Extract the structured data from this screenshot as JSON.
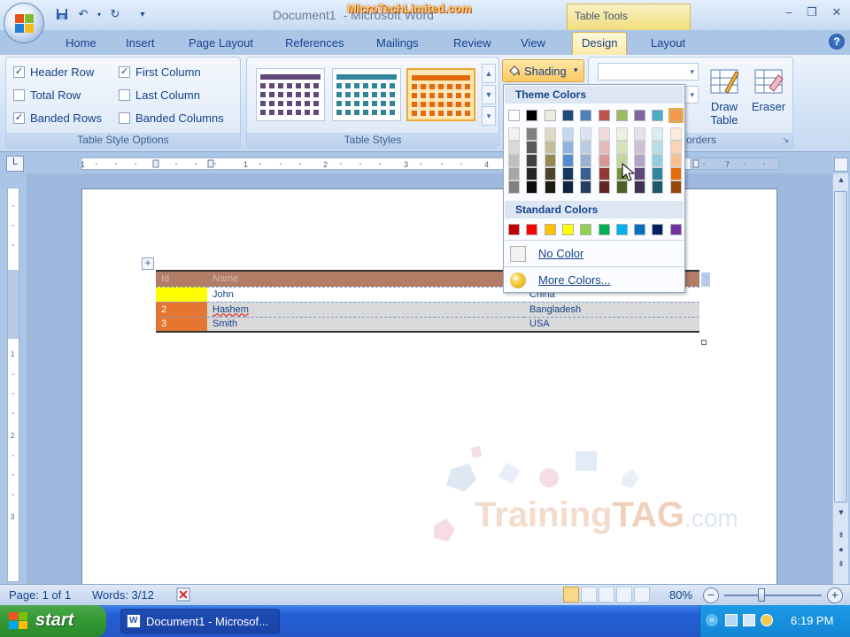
{
  "window": {
    "title": "Document1",
    "title_suffix": "- Microsoft Word",
    "overlay_text": "MicroTechLimited.com",
    "context_tab": "Table Tools",
    "controls": [
      "–",
      "❐",
      "✕"
    ]
  },
  "ribbon_tabs": [
    "Home",
    "Insert",
    "Page Layout",
    "References",
    "Mailings",
    "Review",
    "View",
    "Design",
    "Layout"
  ],
  "active_tab": "Design",
  "table_style_options": {
    "label": "Table Style Options",
    "items": [
      {
        "label": "Header Row",
        "checked": true,
        "mark": "✓"
      },
      {
        "label": "First Column",
        "checked": true,
        "mark": "✓"
      },
      {
        "label": "Total Row",
        "checked": false,
        "mark": ""
      },
      {
        "label": "Last Column",
        "checked": false,
        "mark": ""
      },
      {
        "label": "Banded Rows",
        "checked": true,
        "mark": "✓"
      },
      {
        "label": "Banded Columns",
        "checked": false,
        "mark": ""
      }
    ]
  },
  "table_styles": {
    "label": "Table Styles",
    "thumb_colors": [
      "#5f497a",
      "#31859b",
      "#e36c09"
    ]
  },
  "shading": {
    "label": "Shading"
  },
  "draw_borders": {
    "label": "Draw Borders",
    "visible_label": "orders",
    "draw_table": "Draw\nTable",
    "eraser": "Eraser"
  },
  "shading_menu": {
    "theme_header": "Theme Colors",
    "standard_header": "Standard Colors",
    "no_color": "No Color",
    "more_colors": "More Colors...",
    "theme_top_row": [
      "#ffffff",
      "#000000",
      "#eeece1",
      "#1f497d",
      "#4f81bd",
      "#c0504d",
      "#9bbb59",
      "#8064a2",
      "#4bacc6",
      "#f79646"
    ],
    "theme_columns": [
      [
        "#f2f2f2",
        "#d9d9d9",
        "#bfbfbf",
        "#a6a6a6",
        "#808080"
      ],
      [
        "#7f7f7f",
        "#595959",
        "#404040",
        "#262626",
        "#0d0d0d"
      ],
      [
        "#ddd9c3",
        "#c4bd97",
        "#938953",
        "#4a452a",
        "#1e1c11"
      ],
      [
        "#c6d9f0",
        "#8db3e2",
        "#548dd4",
        "#17365d",
        "#0f243e"
      ],
      [
        "#dbe5f1",
        "#b8cce4",
        "#95b3d7",
        "#366092",
        "#244061"
      ],
      [
        "#f2dcdb",
        "#e5b9b7",
        "#d99694",
        "#953734",
        "#632423"
      ],
      [
        "#ebf1dd",
        "#d7e3bc",
        "#c3d69b",
        "#76923c",
        "#4f6128"
      ],
      [
        "#e5e0ec",
        "#ccc1d9",
        "#b2a2c7",
        "#5f497a",
        "#3f3151"
      ],
      [
        "#dbeef3",
        "#b7dde8",
        "#92cddc",
        "#31859b",
        "#205867"
      ],
      [
        "#fdeada",
        "#fbd5b5",
        "#fac08f",
        "#e36c09",
        "#974806"
      ]
    ],
    "standard_colors": [
      "#c00000",
      "#ff0000",
      "#ffc000",
      "#ffff00",
      "#92d050",
      "#00b050",
      "#00b0f0",
      "#0070c0",
      "#002060",
      "#7030a0"
    ]
  },
  "document_table": {
    "header": [
      "Id",
      "Name",
      ""
    ],
    "rows": [
      [
        "1",
        "John",
        "China"
      ],
      [
        "2",
        "Hashem",
        "Bangladesh"
      ],
      [
        "3",
        "Smith",
        "USA"
      ]
    ]
  },
  "watermark": {
    "brand": "Training",
    "brand_tag": "TAG",
    "brand_suffix": ".com"
  },
  "status_bar": {
    "page": "Page: 1 of 1",
    "words": "Words: 3/12",
    "zoom": "80%",
    "zoom_level_percent": 80
  },
  "taskbar": {
    "start": "start",
    "task_button": "Document1 - Microsof...",
    "clock": "6:19 PM"
  }
}
